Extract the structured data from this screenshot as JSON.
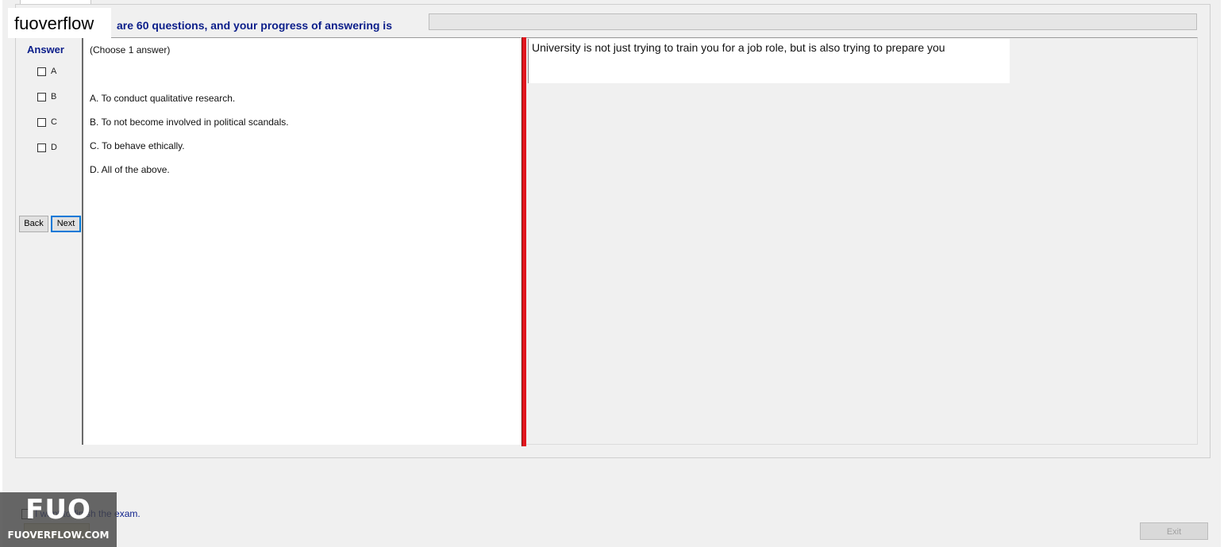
{
  "watermark": {
    "top_text": "fuoverflow",
    "logo": "FUO",
    "site": "FUOVERFLOW.COM"
  },
  "header": {
    "progress_text": "are 60 questions, and your progress of answering is",
    "progress_percent": 0
  },
  "answer_panel": {
    "title": "Answer",
    "options": [
      "A",
      "B",
      "C",
      "D"
    ],
    "back_label": "Back",
    "next_label": "Next"
  },
  "question": {
    "hint": "(Choose 1 answer)",
    "choices": [
      "A.  To conduct qualitative research.",
      "B.  To not become involved in political scandals.",
      "C.  To behave ethically.",
      "D.  All of the above."
    ]
  },
  "context": {
    "text": "University is not just trying to train you for a job role, but is also trying to prepare you"
  },
  "footer": {
    "finish_label": "I want to finish the exam.",
    "exit_label": "Exit"
  },
  "colors": {
    "accent_text": "#0b1e8a",
    "divider": "#e0161e",
    "focus_border": "#0078d7"
  }
}
